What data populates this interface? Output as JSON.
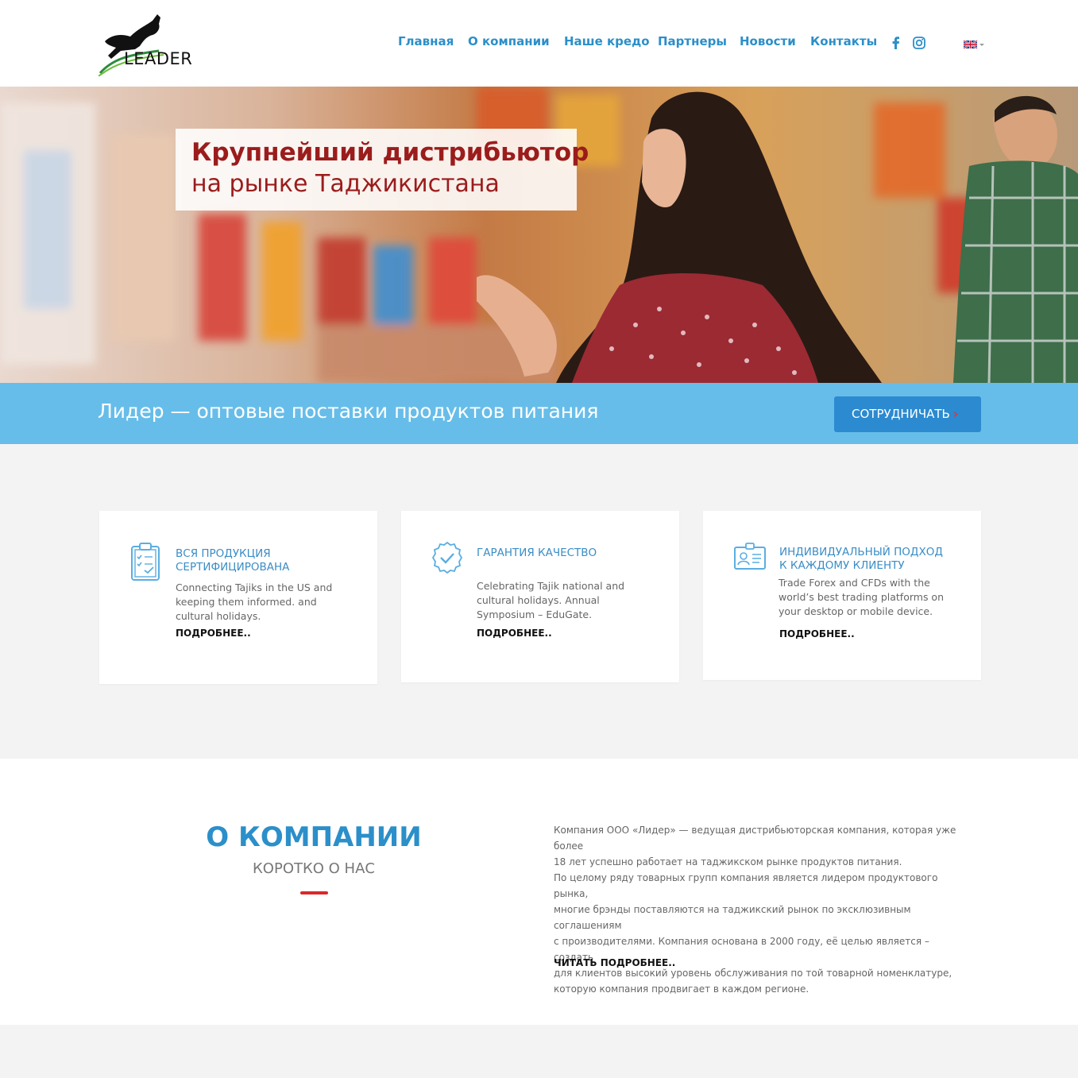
{
  "header": {
    "logo_text": "LEADER",
    "nav": [
      "Главная",
      "О компании",
      "Наше кредо",
      "Партнеры",
      "Новости",
      "Контакты"
    ],
    "social": [
      "facebook-icon",
      "instagram-icon"
    ],
    "language": "en-flag"
  },
  "hero": {
    "title": "Крупнейший дистрибьютор",
    "subtitle": "на рынке Таджикистана"
  },
  "strip": {
    "text": "Лидер — оптовые поставки продуктов питания",
    "button": "СОТРУДНИЧАТЬ"
  },
  "features": [
    {
      "icon": "clipboard-check-icon",
      "title_line1": "ВСЯ ПРОДУКЦИЯ",
      "title_line2": "СЕРТИФИЦИРОВАНА",
      "text_line1": "Connecting Tajiks in the US and",
      "text_line2": "keeping them informed. and",
      "text_line3": "cultural holidays.",
      "link": "ПОДРОБНЕЕ.."
    },
    {
      "icon": "check-badge-icon",
      "title_line1": "ГАРАНТИЯ КАЧЕСТВО",
      "title_line2": "",
      "text_line1": "Celebrating Tajik national and",
      "text_line2": "cultural holidays. Annual",
      "text_line3": "Symposium – EduGate.",
      "link": "ПОДРОБНЕЕ.."
    },
    {
      "icon": "id-card-icon",
      "title_line1": "ИНДИВИДУАЛЬНЫЙ ПОДХОД",
      "title_line2": "К КАЖДОМУ КЛИЕНТУ",
      "text_line1": "Trade Forex and CFDs with the",
      "text_line2": "world’s best trading platforms on",
      "text_line3": "your desktop or mobile device.",
      "link": "ПОДРОБНЕЕ.."
    }
  ],
  "about": {
    "title": "О КОМПАНИИ",
    "subtitle": "КОРОТКО О НАС",
    "lines": [
      "Компания ООО «Лидер» — ведущая дистрибьюторская компания, которая уже более",
      "18 лет успешно работает на таджикском рынке продуктов питания.",
      "По целому ряду товарных групп компания является лидером продуктового рынка,",
      "многие брэнды поставляются на таджикский рынок по эксклюзивным соглашениям",
      "с производителями. Компания основана в 2000 году, её целью является – создать",
      "для клиентов высокий уровень обслуживания по той товарной номенклатуре,",
      "которую компания продвигает в каждом регионе."
    ],
    "link": "ЧИТАТЬ ПОДРОБНЕЕ.."
  },
  "colors": {
    "nav": "#2b8fc9",
    "hero_title": "#9b1c1c",
    "strip": "#67bde9",
    "button": "#2b8ad0",
    "accent_red": "#d72a2a"
  }
}
